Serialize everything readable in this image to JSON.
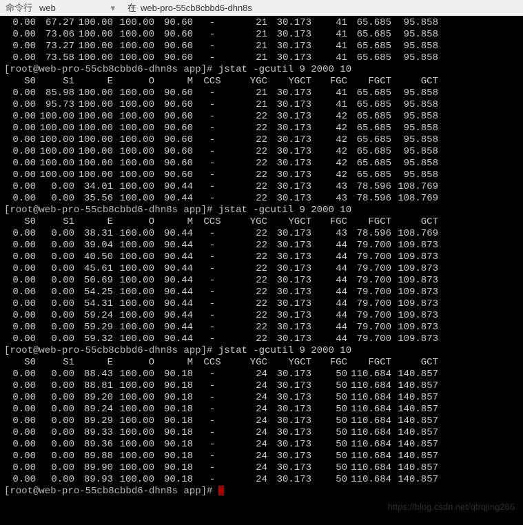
{
  "toolbar": {
    "label": "命令行",
    "dropdown": "web",
    "in_label": "在",
    "host": "web-pro-55cb8cbbd6-dhn8s"
  },
  "prompt_user": "root",
  "prompt_host": "web-pro-55cb8cbbd6-dhn8s",
  "prompt_dir": "app",
  "prompt_symbol": "#",
  "jstat_cmd": "jstat -gcutil 9 2000 10",
  "watermark": "https://blog.csdn.net/qtrqjing266",
  "chart_data": {
    "type": "table",
    "title": "jstat -gcutil output",
    "columns": [
      "S0",
      "S1",
      "E",
      "O",
      "M",
      "CCS",
      "YGC",
      "YGCT",
      "FGC",
      "FGCT",
      "GCT"
    ],
    "blocks": [
      {
        "header": false,
        "rows": [
          [
            "0.00",
            "67.27",
            "100.00",
            "100.00",
            "90.60",
            "-",
            "21",
            "30.173",
            "41",
            "65.685",
            "95.858"
          ],
          [
            "0.00",
            "73.06",
            "100.00",
            "100.00",
            "90.60",
            "-",
            "21",
            "30.173",
            "41",
            "65.685",
            "95.858"
          ],
          [
            "0.00",
            "73.27",
            "100.00",
            "100.00",
            "90.60",
            "-",
            "21",
            "30.173",
            "41",
            "65.685",
            "95.858"
          ],
          [
            "0.00",
            "73.58",
            "100.00",
            "100.00",
            "90.60",
            "-",
            "21",
            "30.173",
            "41",
            "65.685",
            "95.858"
          ]
        ]
      },
      {
        "header": true,
        "rows": [
          [
            "0.00",
            "85.98",
            "100.00",
            "100.00",
            "90.60",
            "-",
            "21",
            "30.173",
            "41",
            "65.685",
            "95.858"
          ],
          [
            "0.00",
            "95.73",
            "100.00",
            "100.00",
            "90.60",
            "-",
            "21",
            "30.173",
            "41",
            "65.685",
            "95.858"
          ],
          [
            "0.00",
            "100.00",
            "100.00",
            "100.00",
            "90.60",
            "-",
            "22",
            "30.173",
            "42",
            "65.685",
            "95.858"
          ],
          [
            "0.00",
            "100.00",
            "100.00",
            "100.00",
            "90.60",
            "-",
            "22",
            "30.173",
            "42",
            "65.685",
            "95.858"
          ],
          [
            "0.00",
            "100.00",
            "100.00",
            "100.00",
            "90.60",
            "-",
            "22",
            "30.173",
            "42",
            "65.685",
            "95.858"
          ],
          [
            "0.00",
            "100.00",
            "100.00",
            "100.00",
            "90.60",
            "-",
            "22",
            "30.173",
            "42",
            "65.685",
            "95.858"
          ],
          [
            "0.00",
            "100.00",
            "100.00",
            "100.00",
            "90.60",
            "-",
            "22",
            "30.173",
            "42",
            "65.685",
            "95.858"
          ],
          [
            "0.00",
            "100.00",
            "100.00",
            "100.00",
            "90.60",
            "-",
            "22",
            "30.173",
            "42",
            "65.685",
            "95.858"
          ],
          [
            "0.00",
            "0.00",
            "34.01",
            "100.00",
            "90.44",
            "-",
            "22",
            "30.173",
            "43",
            "78.596",
            "108.769"
          ],
          [
            "0.00",
            "0.00",
            "35.56",
            "100.00",
            "90.44",
            "-",
            "22",
            "30.173",
            "43",
            "78.596",
            "108.769"
          ]
        ]
      },
      {
        "header": true,
        "rows": [
          [
            "0.00",
            "0.00",
            "38.31",
            "100.00",
            "90.44",
            "-",
            "22",
            "30.173",
            "43",
            "78.596",
            "108.769"
          ],
          [
            "0.00",
            "0.00",
            "39.04",
            "100.00",
            "90.44",
            "-",
            "22",
            "30.173",
            "44",
            "79.700",
            "109.873"
          ],
          [
            "0.00",
            "0.00",
            "40.50",
            "100.00",
            "90.44",
            "-",
            "22",
            "30.173",
            "44",
            "79.700",
            "109.873"
          ],
          [
            "0.00",
            "0.00",
            "45.61",
            "100.00",
            "90.44",
            "-",
            "22",
            "30.173",
            "44",
            "79.700",
            "109.873"
          ],
          [
            "0.00",
            "0.00",
            "50.69",
            "100.00",
            "90.44",
            "-",
            "22",
            "30.173",
            "44",
            "79.700",
            "109.873"
          ],
          [
            "0.00",
            "0.00",
            "54.25",
            "100.00",
            "90.44",
            "-",
            "22",
            "30.173",
            "44",
            "79.700",
            "109.873"
          ],
          [
            "0.00",
            "0.00",
            "54.31",
            "100.00",
            "90.44",
            "-",
            "22",
            "30.173",
            "44",
            "79.700",
            "109.873"
          ],
          [
            "0.00",
            "0.00",
            "59.24",
            "100.00",
            "90.44",
            "-",
            "22",
            "30.173",
            "44",
            "79.700",
            "109.873"
          ],
          [
            "0.00",
            "0.00",
            "59.29",
            "100.00",
            "90.44",
            "-",
            "22",
            "30.173",
            "44",
            "79.700",
            "109.873"
          ],
          [
            "0.00",
            "0.00",
            "59.32",
            "100.00",
            "90.44",
            "-",
            "22",
            "30.173",
            "44",
            "79.700",
            "109.873"
          ]
        ]
      },
      {
        "header": true,
        "rows": [
          [
            "0.00",
            "0.00",
            "88.43",
            "100.00",
            "90.18",
            "-",
            "24",
            "30.173",
            "50",
            "110.684",
            "140.857"
          ],
          [
            "0.00",
            "0.00",
            "88.81",
            "100.00",
            "90.18",
            "-",
            "24",
            "30.173",
            "50",
            "110.684",
            "140.857"
          ],
          [
            "0.00",
            "0.00",
            "89.20",
            "100.00",
            "90.18",
            "-",
            "24",
            "30.173",
            "50",
            "110.684",
            "140.857"
          ],
          [
            "0.00",
            "0.00",
            "89.24",
            "100.00",
            "90.18",
            "-",
            "24",
            "30.173",
            "50",
            "110.684",
            "140.857"
          ],
          [
            "0.00",
            "0.00",
            "89.29",
            "100.00",
            "90.18",
            "-",
            "24",
            "30.173",
            "50",
            "110.684",
            "140.857"
          ],
          [
            "0.00",
            "0.00",
            "89.33",
            "100.00",
            "90.18",
            "-",
            "24",
            "30.173",
            "50",
            "110.684",
            "140.857"
          ],
          [
            "0.00",
            "0.00",
            "89.36",
            "100.00",
            "90.18",
            "-",
            "24",
            "30.173",
            "50",
            "110.684",
            "140.857"
          ],
          [
            "0.00",
            "0.00",
            "89.88",
            "100.00",
            "90.18",
            "-",
            "24",
            "30.173",
            "50",
            "110.684",
            "140.857"
          ],
          [
            "0.00",
            "0.00",
            "89.90",
            "100.00",
            "90.18",
            "-",
            "24",
            "30.173",
            "50",
            "110.684",
            "140.857"
          ],
          [
            "0.00",
            "0.00",
            "89.93",
            "100.00",
            "90.18",
            "-",
            "24",
            "30.173",
            "50",
            "110.684",
            "140.857"
          ]
        ]
      }
    ]
  }
}
